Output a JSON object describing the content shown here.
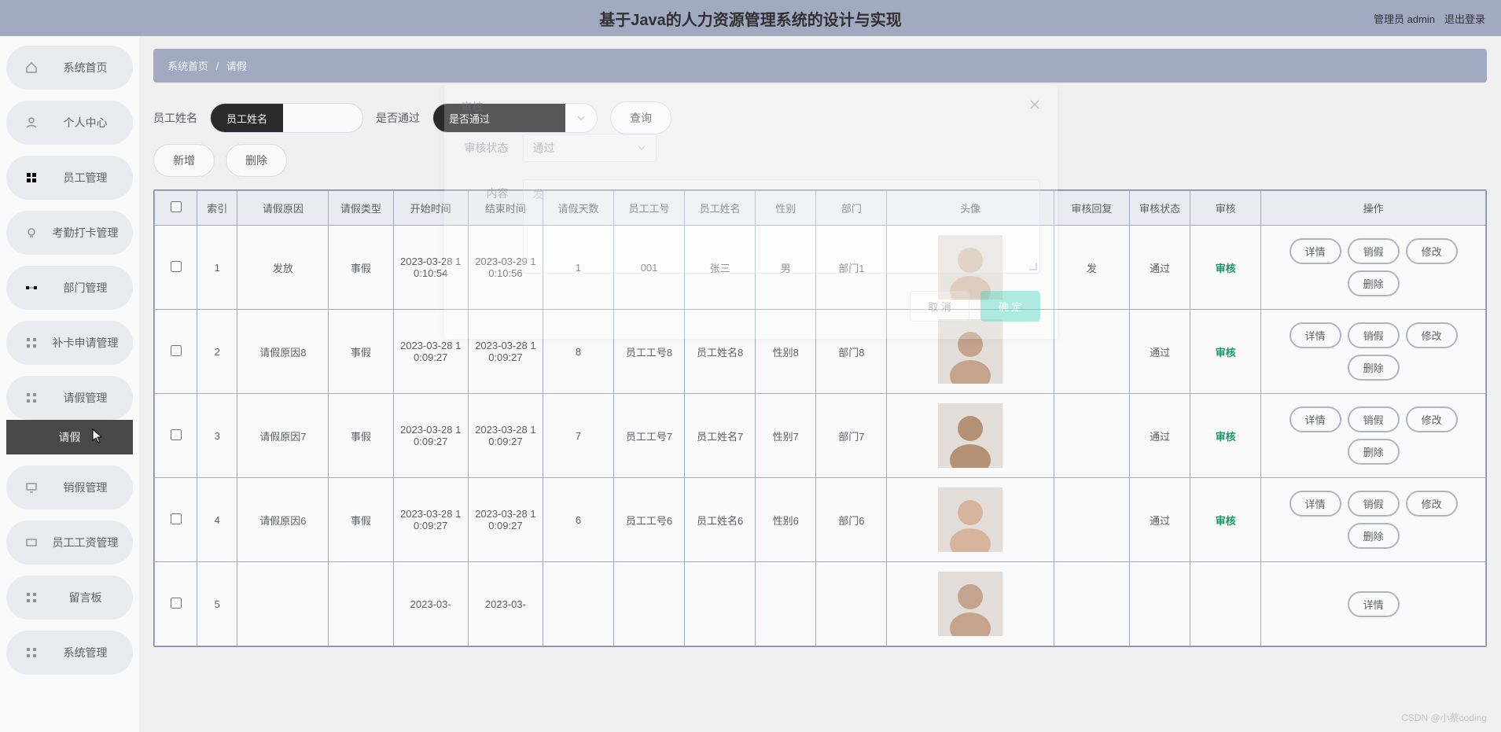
{
  "header": {
    "title": "基于Java的人力资源管理系统的设计与实现",
    "admin_label": "管理员 admin",
    "logout": "退出登录"
  },
  "sidebar": {
    "items": [
      {
        "label": "系统首页",
        "icon": "home"
      },
      {
        "label": "个人中心",
        "icon": "user"
      },
      {
        "label": "员工管理",
        "icon": "grid"
      },
      {
        "label": "考勤打卡管理",
        "icon": "bulb"
      },
      {
        "label": "部门管理",
        "icon": "org"
      },
      {
        "label": "补卡申请管理",
        "icon": "apps"
      },
      {
        "label": "请假管理",
        "icon": "apps"
      },
      {
        "label": "销假管理",
        "icon": "monitor"
      },
      {
        "label": "员工工资管理",
        "icon": "money"
      },
      {
        "label": "留言板",
        "icon": "apps"
      },
      {
        "label": "系统管理",
        "icon": "apps"
      }
    ],
    "sub_active": "请假"
  },
  "breadcrumb": {
    "root": "系统首页",
    "sep": "/",
    "current": "请假"
  },
  "filters": {
    "emp_label": "员工姓名",
    "emp_placeholder": "员工姓名",
    "pass_label": "是否通过",
    "pass_placeholder": "是否通过",
    "search": "查询"
  },
  "actions": {
    "add": "新增",
    "delete": "删除"
  },
  "table": {
    "headers": [
      "",
      "索引",
      "请假原因",
      "请假类型",
      "开始时间",
      "结束时间",
      "请假天数",
      "员工工号",
      "员工姓名",
      "性别",
      "部门",
      "头像",
      "审核回复",
      "审核状态",
      "审核",
      "操作"
    ],
    "op_labels": {
      "detail": "详情",
      "cancel": "销假",
      "edit": "修改",
      "delete": "删除"
    },
    "audit_label": "审核",
    "rows": [
      {
        "idx": "1",
        "reason": "发放",
        "type": "事假",
        "start": "2023-03-28 10:10:54",
        "end": "2023-03-29 10:10:56",
        "days": "1",
        "empno": "001",
        "empname": "张三",
        "sex": "男",
        "dept": "部门1",
        "reply": "发",
        "status": "通过"
      },
      {
        "idx": "2",
        "reason": "请假原因8",
        "type": "事假",
        "start": "2023-03-28 10:09:27",
        "end": "2023-03-28 10:09:27",
        "days": "8",
        "empno": "员工工号8",
        "empname": "员工姓名8",
        "sex": "性别8",
        "dept": "部门8",
        "reply": "",
        "status": "通过"
      },
      {
        "idx": "3",
        "reason": "请假原因7",
        "type": "事假",
        "start": "2023-03-28 10:09:27",
        "end": "2023-03-28 10:09:27",
        "days": "7",
        "empno": "员工工号7",
        "empname": "员工姓名7",
        "sex": "性别7",
        "dept": "部门7",
        "reply": "",
        "status": "通过"
      },
      {
        "idx": "4",
        "reason": "请假原因6",
        "type": "事假",
        "start": "2023-03-28 10:09:27",
        "end": "2023-03-28 10:09:27",
        "days": "6",
        "empno": "员工工号6",
        "empname": "员工姓名6",
        "sex": "性别6",
        "dept": "部门6",
        "reply": "",
        "status": "通过"
      },
      {
        "idx": "5",
        "reason": "",
        "type": "",
        "start": "2023-03-",
        "end": "2023-03-",
        "days": "",
        "empno": "",
        "empname": "",
        "sex": "",
        "dept": "",
        "reply": "",
        "status": ""
      }
    ]
  },
  "modal": {
    "title": "审核",
    "status_label": "审核状态",
    "status_value": "通过",
    "content_label": "内容",
    "content_value": "发",
    "cancel": "取 消",
    "confirm": "确 定"
  },
  "watermark": "CSDN @小蔡coding"
}
